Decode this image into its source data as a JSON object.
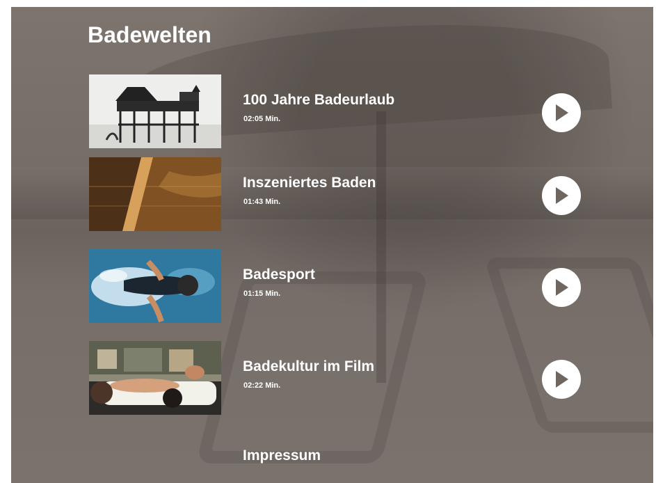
{
  "page": {
    "title": "Badewelten"
  },
  "videos": [
    {
      "title": "100 Jahre Badeurlaub",
      "duration": "02:05 Min.",
      "thumbnail_icon": "beach-pavilion-image",
      "play_icon": "play-icon"
    },
    {
      "title": "Inszeniertes Baden",
      "duration": "01:43 Min.",
      "thumbnail_icon": "stage-bath-image",
      "play_icon": "play-icon"
    },
    {
      "title": "Badesport",
      "duration": "01:15 Min.",
      "thumbnail_icon": "swimmer-image",
      "play_icon": "play-icon"
    },
    {
      "title": "Badekultur im Film",
      "duration": "02:22 Min.",
      "thumbnail_icon": "film-bath-image",
      "play_icon": "play-icon"
    }
  ],
  "footer": {
    "impressum": "Impressum"
  },
  "colors": {
    "overlay": "#6f6660",
    "text": "#ffffff",
    "play_button": "#ffffff",
    "play_arrow": "#6f6660"
  }
}
